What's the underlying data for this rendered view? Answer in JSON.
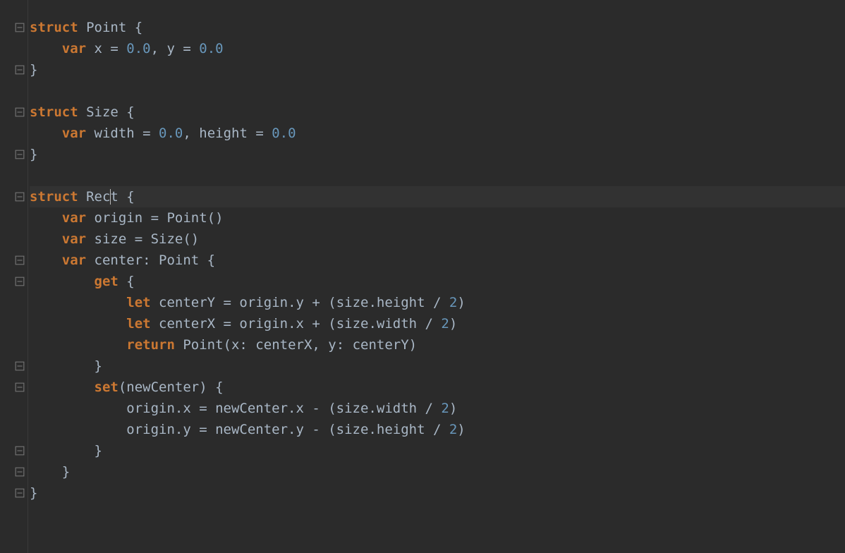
{
  "colors": {
    "background": "#2b2b2b",
    "keyword": "#cc7832",
    "identifier": "#a9b7c6",
    "number": "#6897bb",
    "currentLine": "#323232"
  },
  "cursor": {
    "line": 8,
    "afterText": "Rec"
  },
  "foldMarkers": [
    {
      "line": 0,
      "type": "open"
    },
    {
      "line": 2,
      "type": "close"
    },
    {
      "line": 4,
      "type": "open"
    },
    {
      "line": 6,
      "type": "close"
    },
    {
      "line": 8,
      "type": "open"
    },
    {
      "line": 11,
      "type": "open"
    },
    {
      "line": 12,
      "type": "open"
    },
    {
      "line": 16,
      "type": "close"
    },
    {
      "line": 17,
      "type": "open"
    },
    {
      "line": 20,
      "type": "close"
    },
    {
      "line": 21,
      "type": "close"
    },
    {
      "line": 22,
      "type": "close"
    }
  ],
  "code": {
    "lines": [
      [
        {
          "t": "struct ",
          "c": "kw"
        },
        {
          "t": "Point ",
          "c": "id"
        },
        {
          "t": "{",
          "c": "punct"
        }
      ],
      [
        {
          "t": "    ",
          "c": "id"
        },
        {
          "t": "var ",
          "c": "kw"
        },
        {
          "t": "x = ",
          "c": "id"
        },
        {
          "t": "0.0",
          "c": "num"
        },
        {
          "t": ", ",
          "c": "punct"
        },
        {
          "t": "y = ",
          "c": "id"
        },
        {
          "t": "0.0",
          "c": "num"
        }
      ],
      [
        {
          "t": "}",
          "c": "punct"
        }
      ],
      [],
      [
        {
          "t": "struct ",
          "c": "kw"
        },
        {
          "t": "Size ",
          "c": "id"
        },
        {
          "t": "{",
          "c": "punct"
        }
      ],
      [
        {
          "t": "    ",
          "c": "id"
        },
        {
          "t": "var ",
          "c": "kw"
        },
        {
          "t": "width = ",
          "c": "id"
        },
        {
          "t": "0.0",
          "c": "num"
        },
        {
          "t": ", ",
          "c": "punct"
        },
        {
          "t": "height = ",
          "c": "id"
        },
        {
          "t": "0.0",
          "c": "num"
        }
      ],
      [
        {
          "t": "}",
          "c": "punct"
        }
      ],
      [],
      [
        {
          "t": "struct ",
          "c": "kw"
        },
        {
          "t": "Rect ",
          "c": "id"
        },
        {
          "t": "{",
          "c": "punct"
        }
      ],
      [
        {
          "t": "    ",
          "c": "id"
        },
        {
          "t": "var ",
          "c": "kw"
        },
        {
          "t": "origin = Point()",
          "c": "id"
        }
      ],
      [
        {
          "t": "    ",
          "c": "id"
        },
        {
          "t": "var ",
          "c": "kw"
        },
        {
          "t": "size = Size()",
          "c": "id"
        }
      ],
      [
        {
          "t": "    ",
          "c": "id"
        },
        {
          "t": "var ",
          "c": "kw"
        },
        {
          "t": "center: Point {",
          "c": "id"
        }
      ],
      [
        {
          "t": "        ",
          "c": "id"
        },
        {
          "t": "get ",
          "c": "kw"
        },
        {
          "t": "{",
          "c": "punct"
        }
      ],
      [
        {
          "t": "            ",
          "c": "id"
        },
        {
          "t": "let ",
          "c": "kw"
        },
        {
          "t": "centerY = origin.y + (size.height / ",
          "c": "id"
        },
        {
          "t": "2",
          "c": "num"
        },
        {
          "t": ")",
          "c": "punct"
        }
      ],
      [
        {
          "t": "            ",
          "c": "id"
        },
        {
          "t": "let ",
          "c": "kw"
        },
        {
          "t": "centerX = origin.x + (size.width / ",
          "c": "id"
        },
        {
          "t": "2",
          "c": "num"
        },
        {
          "t": ")",
          "c": "punct"
        }
      ],
      [
        {
          "t": "            ",
          "c": "id"
        },
        {
          "t": "return ",
          "c": "kw"
        },
        {
          "t": "Point(x: centerX, y: centerY)",
          "c": "id"
        }
      ],
      [
        {
          "t": "        }",
          "c": "punct"
        }
      ],
      [
        {
          "t": "        ",
          "c": "id"
        },
        {
          "t": "set",
          "c": "kw"
        },
        {
          "t": "(newCenter) {",
          "c": "id"
        }
      ],
      [
        {
          "t": "            origin.x = newCenter.x - (size.width / ",
          "c": "id"
        },
        {
          "t": "2",
          "c": "num"
        },
        {
          "t": ")",
          "c": "punct"
        }
      ],
      [
        {
          "t": "            origin.y = newCenter.y - (size.height / ",
          "c": "id"
        },
        {
          "t": "2",
          "c": "num"
        },
        {
          "t": ")",
          "c": "punct"
        }
      ],
      [
        {
          "t": "        }",
          "c": "punct"
        }
      ],
      [
        {
          "t": "    }",
          "c": "punct"
        }
      ],
      [
        {
          "t": "}",
          "c": "punct"
        }
      ]
    ]
  }
}
